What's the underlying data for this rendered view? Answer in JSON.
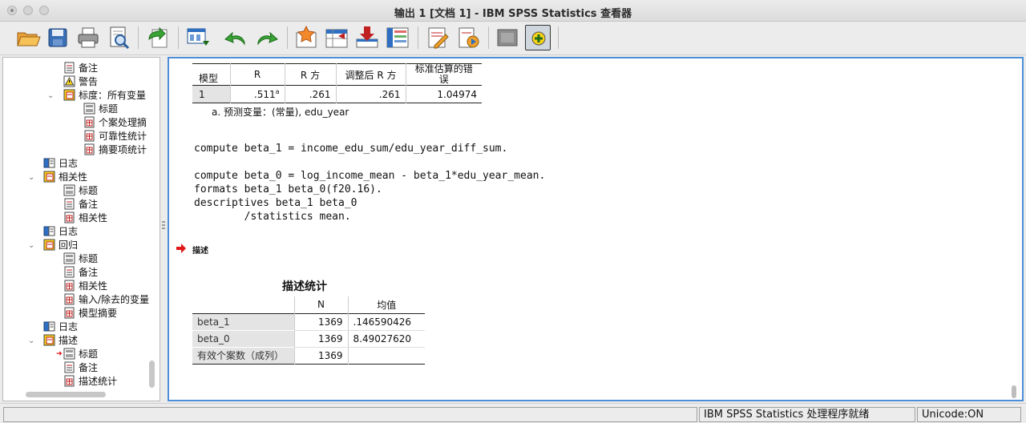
{
  "window": {
    "title": "输出 1 [文档 1] - IBM SPSS Statistics 查看器"
  },
  "toolbar": {
    "buttons": [
      "open-icon",
      "save-icon",
      "print-icon",
      "print-preview-icon",
      "export-icon",
      "dialog-recall-icon",
      "undo-icon",
      "redo-icon",
      "go-to-data-icon",
      "go-to-case-icon",
      "go-to-variable-icon",
      "variables-icon",
      "edit-syntax-icon",
      "run-script-icon",
      "designate-window-icon",
      "insert-output-icon"
    ]
  },
  "tree": {
    "items": [
      {
        "label": "备注",
        "icon": "notes-icon"
      },
      {
        "label": "警告",
        "icon": "warning-icon"
      },
      {
        "label": "标度：所有变量",
        "icon": "procedure-icon"
      },
      {
        "label": "标题",
        "icon": "title-icon"
      },
      {
        "label": "个案处理摘",
        "icon": "table-icon"
      },
      {
        "label": "可靠性统计",
        "icon": "table-icon"
      },
      {
        "label": "摘要项统计",
        "icon": "table-icon"
      },
      {
        "label": "日志",
        "icon": "log-icon"
      },
      {
        "label": "相关性",
        "icon": "procedure-icon"
      },
      {
        "label": "标题",
        "icon": "title-icon"
      },
      {
        "label": "备注",
        "icon": "notes-icon"
      },
      {
        "label": "相关性",
        "icon": "table-icon"
      },
      {
        "label": "日志",
        "icon": "log-icon"
      },
      {
        "label": "回归",
        "icon": "procedure-icon"
      },
      {
        "label": "标题",
        "icon": "title-icon"
      },
      {
        "label": "备注",
        "icon": "notes-icon"
      },
      {
        "label": "相关性",
        "icon": "table-icon"
      },
      {
        "label": "输入/除去的变量",
        "icon": "table-icon"
      },
      {
        "label": "模型摘要",
        "icon": "table-icon"
      },
      {
        "label": "日志",
        "icon": "log-icon"
      },
      {
        "label": "描述",
        "icon": "procedure-icon"
      },
      {
        "label": "标题",
        "icon": "title-icon"
      },
      {
        "label": "备注",
        "icon": "notes-icon"
      },
      {
        "label": "描述统计",
        "icon": "table-icon"
      }
    ]
  },
  "model_summary": {
    "headers": [
      "模型",
      "R",
      "R 方",
      "调整后 R 方",
      "标准估算的错误"
    ],
    "row": [
      "1",
      ".511",
      ".261",
      ".261",
      "1.04974"
    ],
    "r_superscript": "a",
    "footnote": "a. 预测变量：(常量), edu_year"
  },
  "syntax": {
    "lines": [
      "compute beta_1 = income_edu_sum/edu_year_diff_sum.",
      "",
      "compute beta_0 = log_income_mean - beta_1*edu_year_mean.",
      "formats beta_1 beta_0(f20.16).",
      "descriptives beta_1 beta_0",
      "        /statistics mean."
    ]
  },
  "procedure_heading": "描述",
  "descriptives": {
    "title": "描述统计",
    "col_n": "N",
    "col_mean": "均值",
    "rows": [
      {
        "label": "beta_1",
        "n": "1369",
        "mean": ".146590426"
      },
      {
        "label": "beta_0",
        "n": "1369",
        "mean": "8.49027620"
      },
      {
        "label": "有效个案数（成列）",
        "n": "1369",
        "mean": ""
      }
    ]
  },
  "status": {
    "processor": "IBM SPSS Statistics 处理程序就绪",
    "unicode": "Unicode:ON"
  }
}
